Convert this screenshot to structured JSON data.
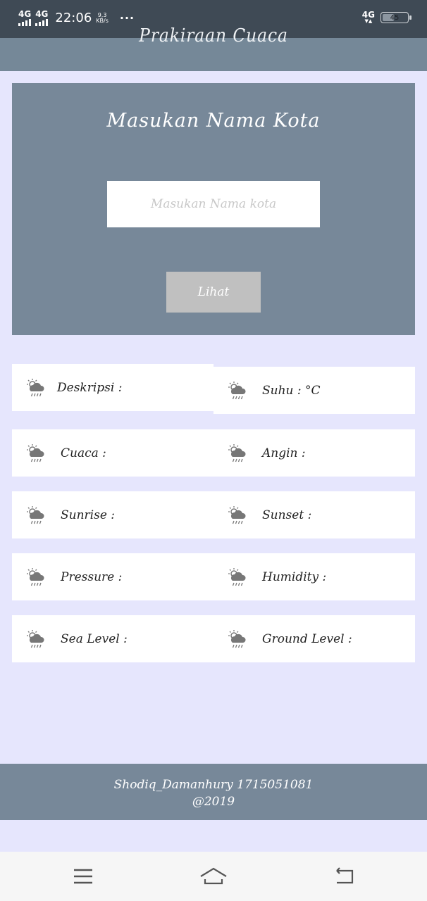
{
  "status_bar": {
    "network_1": "4G",
    "network_2": "4G",
    "time": "22:06",
    "speed_value": "9,3",
    "speed_unit": "KB/s",
    "more": "···",
    "network_right": "4G",
    "battery_level": "45"
  },
  "header": {
    "title": "Prakiraan Cuaca"
  },
  "search": {
    "heading": "Masukan Nama Kota",
    "placeholder": "Masukan Nama kota",
    "button_label": "Lihat"
  },
  "info": {
    "deskripsi": "Deskripsi :",
    "suhu": "Suhu : °C",
    "cuaca": "Cuaca :",
    "angin": "Angin :",
    "sunrise": "Sunrise :",
    "sunset": "Sunset :",
    "pressure": "Pressure :",
    "humidity": "Humidity :",
    "sea_level": "Sea Level :",
    "ground_level": "Ground Level :",
    "icon": "weather-icon"
  },
  "footer": {
    "credit": "Shodiq_Damanhury 1715051081",
    "year": "@2019"
  },
  "colors": {
    "background": "#e6e6fd",
    "primary": "#778899",
    "card": "#ffffff",
    "button": "#c0c0c0"
  }
}
